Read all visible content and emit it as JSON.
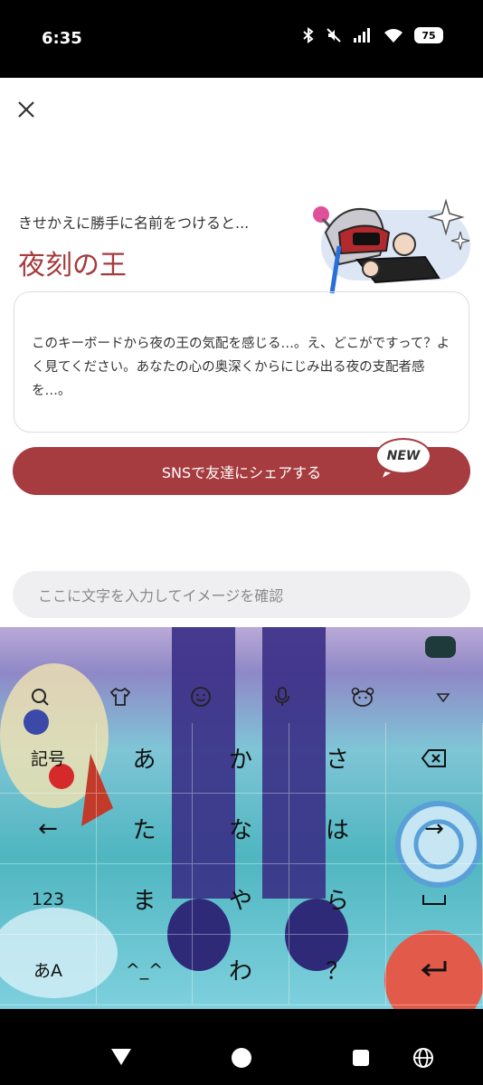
{
  "status_bar": {
    "time": "6:35",
    "battery": "75"
  },
  "header": {
    "subtitle": "きせかえに勝手に名前をつけると...",
    "title": "夜刻の王"
  },
  "card": {
    "text": "このキーボードから夜の王の気配を感じる…。え、どこがですって？よく見てください。あなたの心の奥深くからにじみ出る夜の支配者感を…。"
  },
  "share": {
    "label": "SNSで友達にシェアする",
    "badge": "NEW"
  },
  "preview_input": {
    "placeholder": "ここに文字を入力してイメージを確認"
  },
  "keyboard": {
    "rows": [
      [
        "記号",
        "あ",
        "か",
        "さ",
        "⌫"
      ],
      [
        "←",
        "た",
        "な",
        "は",
        "→"
      ],
      [
        "123",
        "ま",
        "や",
        "ら",
        "␣"
      ],
      [
        "あA",
        "^_^",
        "わ",
        "？",
        "↵"
      ]
    ]
  },
  "colors": {
    "accent": "#a63c3f"
  }
}
